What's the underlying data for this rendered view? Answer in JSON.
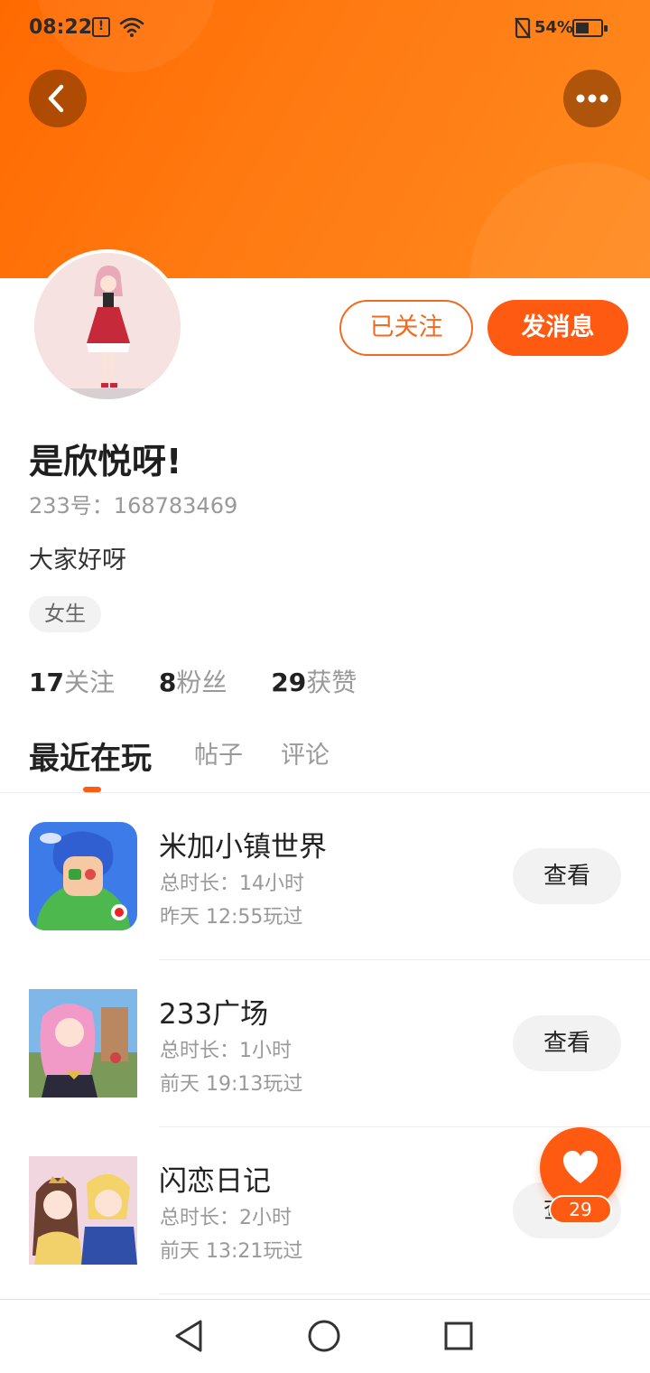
{
  "status_bar": {
    "time": "08:22",
    "alert_glyph": "!",
    "battery_percent": "54%",
    "battery_level": 0.54,
    "icons": [
      "alert-icon",
      "wifi-icon",
      "nfc-icon",
      "battery-icon"
    ]
  },
  "header": {
    "back_icon": "chevron-left-icon",
    "more_icon": "more-dots-icon",
    "accent_color": "#ff6a00"
  },
  "profile": {
    "follow_label": "已关注",
    "message_label": "发消息",
    "username": "是欣悦呀!",
    "user_id": "233号：168783469",
    "bio": "大家好呀",
    "gender_tag": "女生",
    "stats": [
      {
        "num": "17",
        "label": "关注"
      },
      {
        "num": "8",
        "label": "粉丝"
      },
      {
        "num": "29",
        "label": "获赞"
      }
    ]
  },
  "tabs": [
    {
      "label": "最近在玩",
      "active": true
    },
    {
      "label": "帖子",
      "active": false
    },
    {
      "label": "评论",
      "active": false
    }
  ],
  "games": [
    {
      "name": "米加小镇世界",
      "duration": "总时长：14小时",
      "last_played": "昨天 12:55玩过",
      "action": "查看"
    },
    {
      "name": "233广场",
      "duration": "总时长：1小时",
      "last_played": "前天 19:13玩过",
      "action": "查看"
    },
    {
      "name": "闪恋日记",
      "duration": "总时长：2小时",
      "last_played": "前天 13:21玩过",
      "action": "查看"
    }
  ],
  "like_fab": {
    "icon": "heart-icon",
    "count": "29"
  },
  "nav": {
    "icons": [
      "nav-back-icon",
      "nav-home-icon",
      "nav-recents-icon"
    ]
  }
}
